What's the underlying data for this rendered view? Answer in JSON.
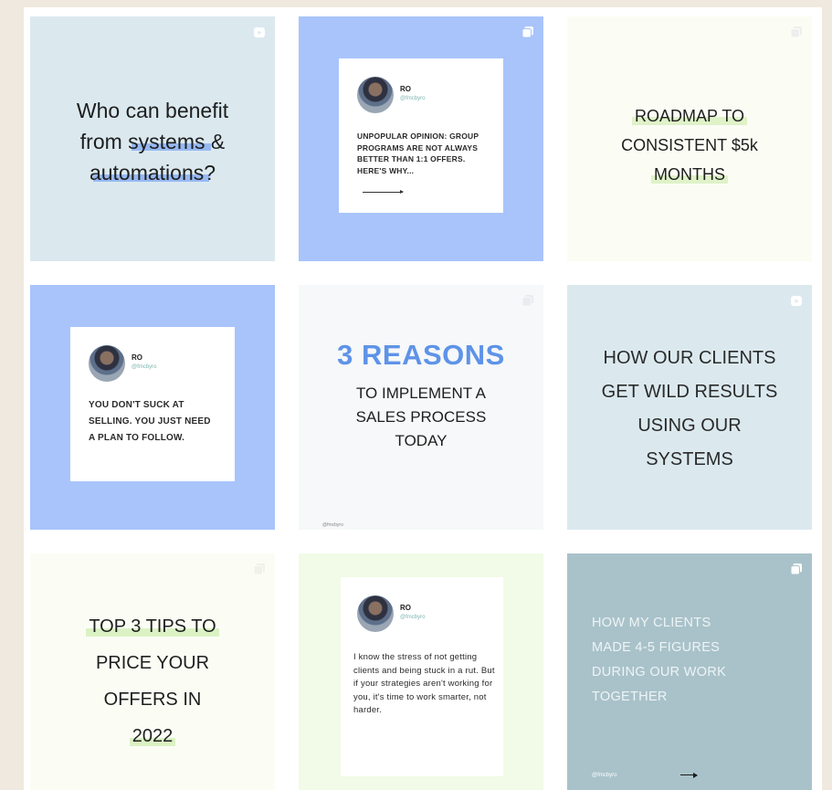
{
  "posts": [
    {
      "id_label": "post-benefit",
      "lines": [
        "Who can benefit",
        "from ",
        "systems",
        " &",
        "automations",
        "?"
      ]
    },
    {
      "card": {
        "name": "RO",
        "handle": "@fmcbyro",
        "body": "UNPOPULAR OPINION: GROUP PROGRAMS ARE NOT ALWAYS BETTER THAN 1:1 OFFERS. HERE'S WHY..."
      }
    },
    {
      "lines": [
        "ROADMAP TO",
        "CONSISTENT $5k",
        "MONTHS"
      ]
    },
    {
      "card": {
        "name": "RO",
        "handle": "@fmcbyro",
        "body": "YOU DON'T SUCK AT SELLING. YOU JUST NEED A PLAN TO FOLLOW."
      }
    },
    {
      "title": "3 REASONS",
      "subtitle": "TO IMPLEMENT A SALES PROCESS TODAY",
      "footnote": "@fmcbyro"
    },
    {
      "lines": [
        "HOW OUR CLIENTS",
        "GET WILD RESULTS",
        "USING OUR",
        "SYSTEMS"
      ]
    },
    {
      "lines": [
        "TOP 3 TIPS TO",
        "PRICE YOUR",
        "OFFERS IN",
        "2022"
      ]
    },
    {
      "card": {
        "name": "RO",
        "handle": "@fmcbyro",
        "body": "I know the stress of not getting clients and being stuck in a rut. But if your strategies aren't working for you, it's time to work smarter, not harder."
      }
    },
    {
      "lines": [
        "HOW MY CLIENTS",
        "MADE 4-5 FIGURES",
        "DURING OUR WORK",
        "TOGETHER"
      ],
      "handle": "@fmcbyro"
    }
  ],
  "icons": {
    "reel": "reel-icon",
    "carousel": "carousel-icon"
  },
  "colors": {
    "light_blue": "#dbe9ef",
    "periwinkle": "#a8c4fb",
    "accent_blue": "#5e93e8",
    "highlight_green": "#dbf2c4",
    "steel": "#a9c2ca"
  }
}
